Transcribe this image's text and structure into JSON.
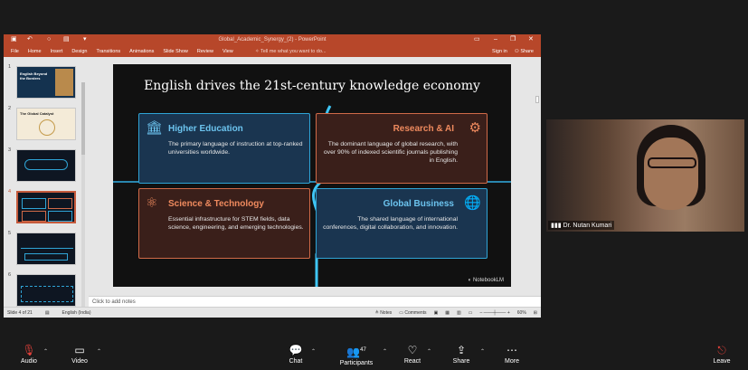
{
  "powerpoint": {
    "title": "Global_Academic_Synergy_(2)  -  PowerPoint",
    "ribbon_tabs": [
      "File",
      "Home",
      "Insert",
      "Design",
      "Transitions",
      "Animations",
      "Slide Show",
      "Review",
      "View"
    ],
    "tell_me": "Tell me what you want to do...",
    "sign_in": "Sign in",
    "share": "Share",
    "thumbnails": [
      "1",
      "2",
      "3",
      "4",
      "5",
      "6"
    ],
    "thumb_texts": {
      "t1": "English Beyond the Borders",
      "t2": "The Global Catalyst"
    },
    "notes_placeholder": "Click to add notes",
    "status": {
      "slide": "Slide 4 of 21",
      "language": "English (India)",
      "notes": "Notes",
      "comments": "Comments",
      "zoom": "60%"
    }
  },
  "slide": {
    "title": "English drives the 21st-century knowledge economy",
    "boxes": [
      {
        "heading": "Higher Education",
        "body": "The primary language of instruction at top-ranked universities worldwide.",
        "icon": "building-columns-icon"
      },
      {
        "heading": "Research & AI",
        "body": "The dominant language of global research, with over 90% of indexed scientific journals publishing in English.",
        "icon": "network-icon"
      },
      {
        "heading": "Science & Technology",
        "body": "Essential infrastructure for STEM fields, data science, engineering, and emerging technologies.",
        "icon": "atom-icon"
      },
      {
        "heading": "Global Business",
        "body": "The shared language of international conferences, digital collaboration, and innovation.",
        "icon": "handshake-globe-icon"
      }
    ],
    "watermark": "NotebookLM"
  },
  "video": {
    "participant": "Dr. Nutan Kumari"
  },
  "zoom_toolbar": {
    "audio": "Audio",
    "video": "Video",
    "chat": "Chat",
    "participants": "Participants",
    "participants_count": "47",
    "react": "React",
    "share": "Share",
    "more": "More",
    "leave": "Leave"
  },
  "colors": {
    "ppt_red": "#b7472a",
    "blue_accent": "#2fa4d6",
    "orange_accent": "#d06a48"
  }
}
